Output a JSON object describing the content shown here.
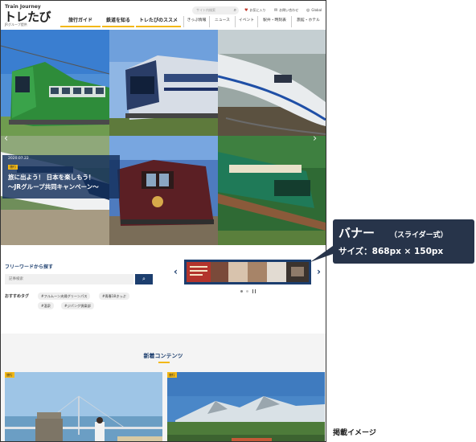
{
  "header": {
    "logo_en": "Train Journey",
    "logo_jp": "トレたび",
    "logo_sub": "JRグループ提供",
    "search_placeholder": "サイト内検索",
    "top_links": [
      {
        "icon": "heart-icon",
        "label": "お気に入り"
      },
      {
        "icon": "mail-icon",
        "label": "お問い合わせ"
      },
      {
        "icon": "globe-icon",
        "label": "Global"
      }
    ],
    "main_nav": [
      "旅行ガイド",
      "鉄道を知る",
      "トレたびのススメ"
    ],
    "sub_nav": [
      "きっぷ情報",
      "ニュース",
      "イベント",
      "駅弁・時刻表",
      "旅館・ホテル"
    ]
  },
  "hero": {
    "date": "2020.07.22",
    "badge": "旅行",
    "title_line1": "旅に出よう！ 日本を楽しもう！",
    "title_line2": "～JRグループ共同キャンペーン～"
  },
  "freeword": {
    "title": "フリーワードから探す",
    "placeholder": "記事検索",
    "recommended_label": "おすすめタグ",
    "tags": [
      "#フルムーン夫婦グリーンパス",
      "#青春18きっぷ",
      "#温泉",
      "#ジパング倶楽部"
    ]
  },
  "banner": {
    "images": [
      "banner-slide-1",
      "banner-slide-2",
      "banner-slide-3"
    ]
  },
  "new_content": {
    "title": "新着コンテンツ",
    "cards": [
      {
        "badge": "旅行"
      },
      {
        "badge": "旅行"
      }
    ]
  },
  "annotation": {
    "title": "バナー",
    "paren": "（スライダー式）",
    "size": "サイズ：868px × 150px",
    "caption": "掲載イメージ"
  },
  "colors": {
    "navy": "#1c3e6e",
    "accent": "#f2b818",
    "callout_bg": "#27344a"
  }
}
